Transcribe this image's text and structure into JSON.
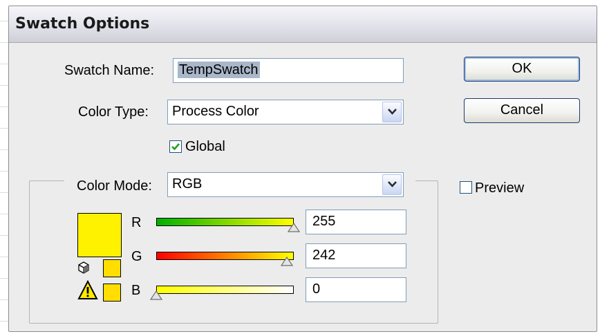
{
  "window": {
    "title": "Swatch Options"
  },
  "form": {
    "swatch_name_label": "Swatch Name:",
    "swatch_name_value": "TempSwatch",
    "color_type_label": "Color Type:",
    "color_type_value": "Process Color",
    "global_label": "Global",
    "global_checked": true,
    "color_mode_label": "Color Mode:",
    "color_mode_value": "RGB"
  },
  "buttons": {
    "ok": "OK",
    "cancel": "Cancel"
  },
  "preview": {
    "label": "Preview",
    "checked": false
  },
  "color": {
    "swatch_hex": "#fff200",
    "gamut_swatch_hex": "#ffde00",
    "channels": [
      {
        "label": "R",
        "value": "255",
        "gradient": [
          "#00b000",
          "#ffff00"
        ]
      },
      {
        "label": "G",
        "value": "242",
        "gradient": [
          "#ff0000",
          "#ffff00"
        ]
      },
      {
        "label": "B",
        "value": "0",
        "gradient": [
          "#ffff00",
          "#ffffff"
        ]
      }
    ]
  },
  "icons": [
    "cube-icon",
    "warning-icon",
    "checkmark-icon",
    "dropdown-arrow-icon",
    "slider-thumb-icon"
  ]
}
